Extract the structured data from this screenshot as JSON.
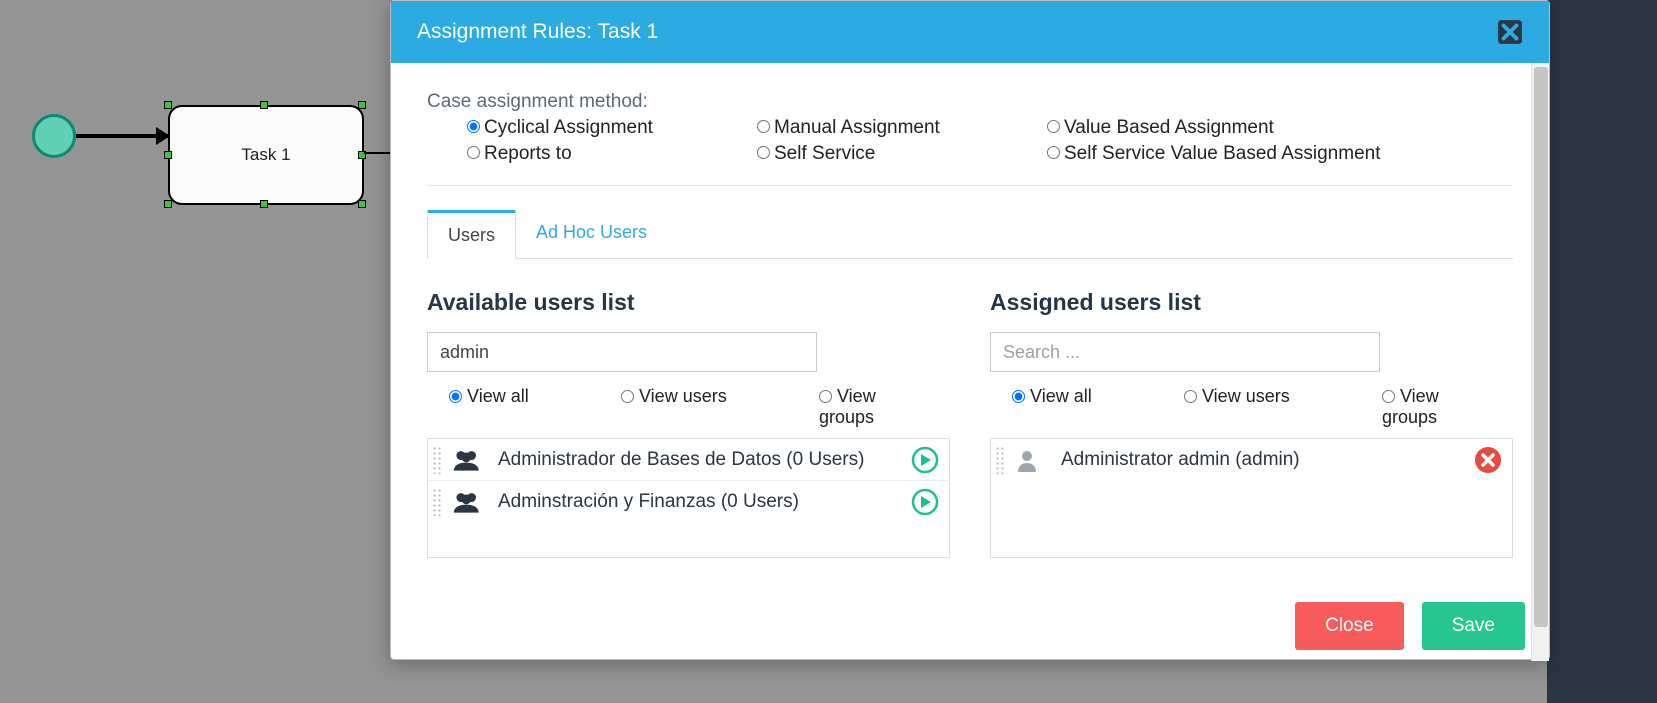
{
  "modal": {
    "title": "Assignment Rules: Task 1",
    "close_btn": "Close",
    "save_btn": "Save"
  },
  "canvas": {
    "task_label": "Task 1"
  },
  "method": {
    "label": "Case assignment method:",
    "options": {
      "cyclical": "Cyclical Assignment",
      "manual": "Manual Assignment",
      "value_based": "Value Based Assignment",
      "reports_to": "Reports to",
      "self_service": "Self Service",
      "ss_value_based": "Self Service Value Based Assignment"
    },
    "selected": "cyclical"
  },
  "tabs": {
    "users": "Users",
    "adhoc": "Ad Hoc Users"
  },
  "available": {
    "title": "Available users list",
    "search_value": "admin",
    "filters": {
      "all": "View all",
      "users": "View users",
      "groups": "View groups"
    },
    "items": [
      {
        "label": "Administrador de Bases de Datos (0 Users)",
        "type": "group"
      },
      {
        "label": "Adminstración y Finanzas (0 Users)",
        "type": "group"
      }
    ]
  },
  "assigned": {
    "title": "Assigned users list",
    "search_placeholder": "Search ...",
    "filters": {
      "all": "View all",
      "users": "View users",
      "groups": "View groups"
    },
    "items": [
      {
        "label": "Administrator admin (admin)",
        "type": "user"
      }
    ]
  }
}
